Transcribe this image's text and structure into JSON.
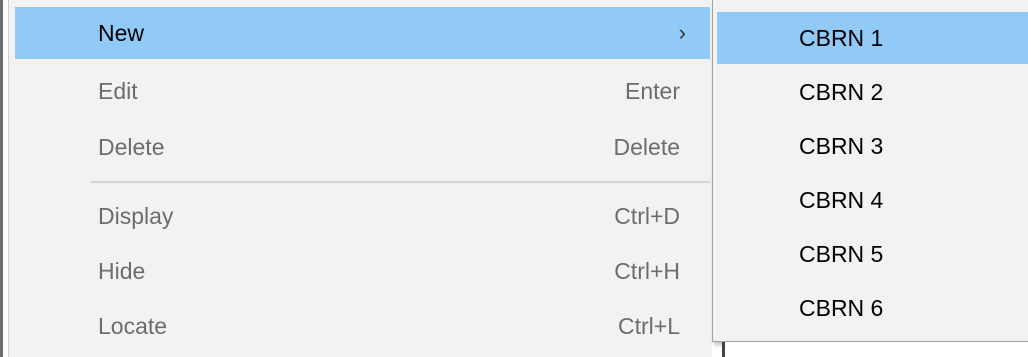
{
  "menu": {
    "items": [
      {
        "label": "New",
        "shortcut": "",
        "submenu_arrow": "›",
        "highlighted": true,
        "enabled": true
      },
      {
        "label": "Edit",
        "shortcut": "Enter",
        "highlighted": false,
        "enabled": false
      },
      {
        "label": "Delete",
        "shortcut": "Delete",
        "highlighted": false,
        "enabled": false
      },
      {
        "label": "Display",
        "shortcut": "Ctrl+D",
        "highlighted": false,
        "enabled": false
      },
      {
        "label": "Hide",
        "shortcut": "Ctrl+H",
        "highlighted": false,
        "enabled": false
      },
      {
        "label": "Locate",
        "shortcut": "Ctrl+L",
        "highlighted": false,
        "enabled": false
      }
    ]
  },
  "submenu": {
    "items": [
      {
        "label": "CBRN 1",
        "highlighted": true
      },
      {
        "label": "CBRN 2",
        "highlighted": false
      },
      {
        "label": "CBRN 3",
        "highlighted": false
      },
      {
        "label": "CBRN 4",
        "highlighted": false
      },
      {
        "label": "CBRN 5",
        "highlighted": false
      },
      {
        "label": "CBRN 6",
        "highlighted": false
      }
    ]
  },
  "colors": {
    "highlight": "#91c9f7",
    "menu_background": "#f2f2f2",
    "disabled_text": "#6d6d6d",
    "enabled_text": "#000000"
  }
}
